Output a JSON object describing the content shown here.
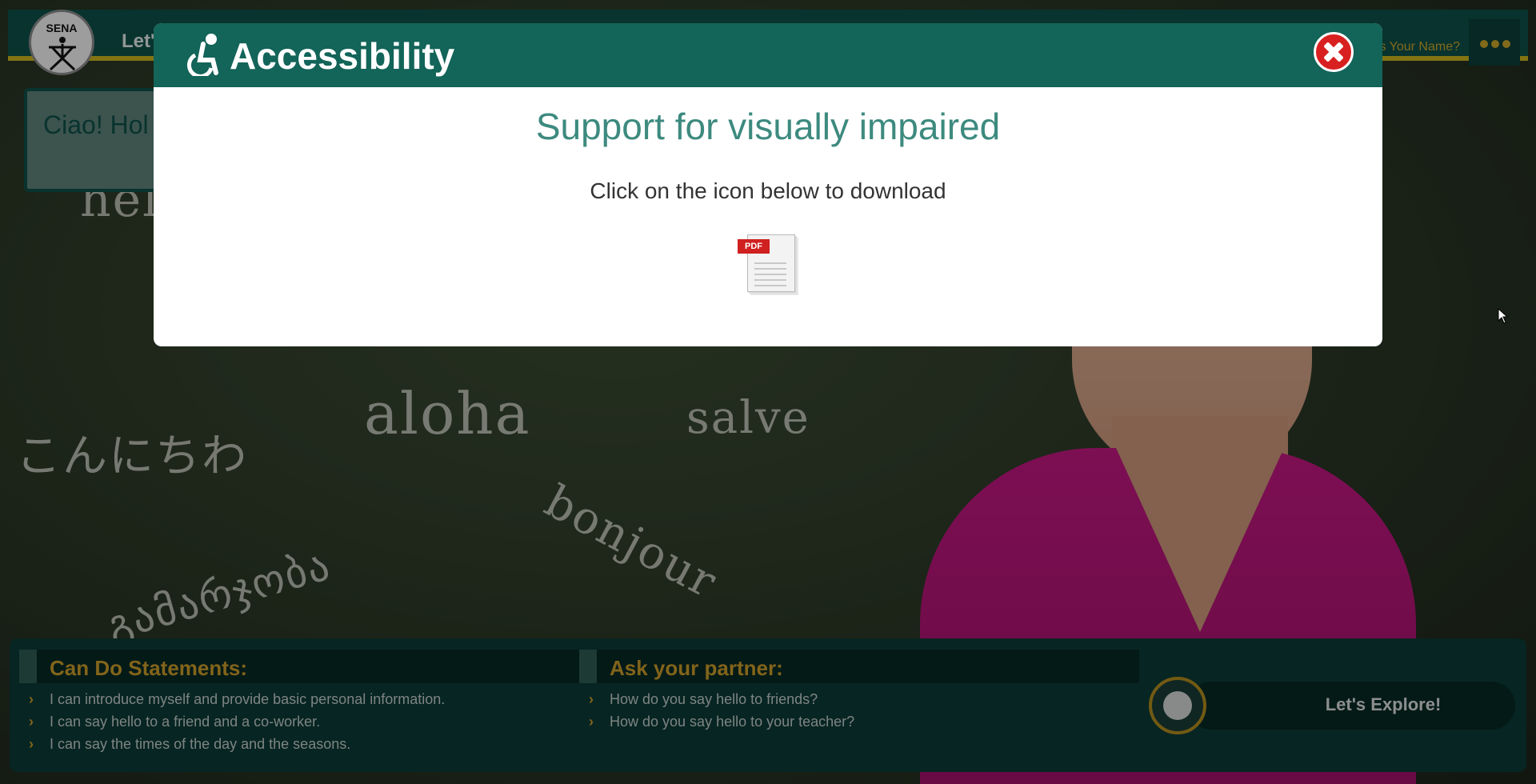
{
  "header": {
    "logo_text": "SENA",
    "lesson_title": "Let's",
    "name_link": "t's Your Name?",
    "menu_icon": "more-dots-icon"
  },
  "speech": {
    "text": "Ciao! Hol co-worke"
  },
  "chalkboard": {
    "words": [
      "hello",
      "こんにちわ",
      "aloha",
      "salve",
      "bonjour",
      "გამარჯობა"
    ]
  },
  "modal": {
    "title": "Accessibility",
    "icon": "wheelchair-icon",
    "subtitle": "Support for visually impaired",
    "instruction": "Click on the icon below to download",
    "download_icon": "pdf-icon",
    "pdf_label": "PDF",
    "close_icon": "close-icon"
  },
  "bottom": {
    "can_do": {
      "title": "Can Do Statements:",
      "items": [
        "I can introduce myself and provide basic personal information.",
        "I can say hello to a friend and a co-worker.",
        "I can say the times of the day and the seasons."
      ]
    },
    "ask_partner": {
      "title": "Ask your partner:",
      "items": [
        "How do you say hello to friends?",
        "How do you say hello to your teacher?"
      ]
    },
    "explore_label": "Let's Explore!"
  },
  "colors": {
    "header_teal": "#136459",
    "accent_gold": "#c89a28",
    "close_red": "#d82020",
    "subtitle_teal": "#3d8a7f"
  }
}
